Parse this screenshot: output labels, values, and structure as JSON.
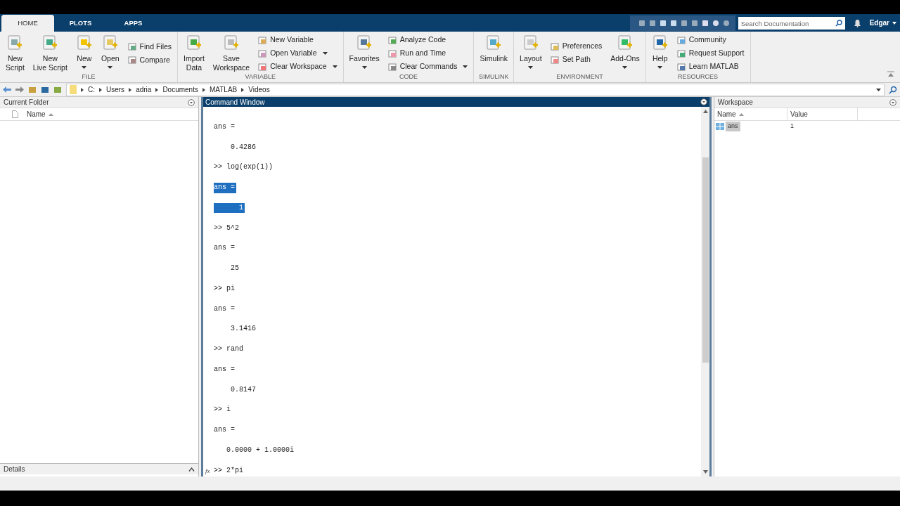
{
  "tabs": [
    {
      "label": "HOME",
      "selected": true
    },
    {
      "label": "PLOTS",
      "selected": false
    },
    {
      "label": "APPS",
      "selected": false
    }
  ],
  "search": {
    "placeholder": "Search Documentation"
  },
  "user": "Edgar",
  "sections": [
    {
      "title": "FILE",
      "columns": [
        {
          "kind": "large",
          "label": "New\nScript",
          "dropdown": false
        },
        {
          "kind": "large",
          "label": "New\nLive Script",
          "dropdown": false
        },
        {
          "kind": "large",
          "label": "New",
          "dropdown": true
        },
        {
          "kind": "large",
          "label": "Open",
          "dropdown": true
        },
        {
          "kind": "stack",
          "items": [
            {
              "label": "Find Files",
              "dropdown": false
            },
            {
              "label": "Compare",
              "dropdown": false
            }
          ]
        }
      ]
    },
    {
      "title": "VARIABLE",
      "columns": [
        {
          "kind": "large",
          "label": "Import\nData",
          "dropdown": false
        },
        {
          "kind": "large",
          "label": "Save\nWorkspace",
          "dropdown": false
        },
        {
          "kind": "stack",
          "items": [
            {
              "label": "New Variable",
              "dropdown": false
            },
            {
              "label": "Open Variable",
              "dropdown": true
            },
            {
              "label": "Clear Workspace",
              "dropdown": true
            }
          ]
        }
      ]
    },
    {
      "title": "CODE",
      "columns": [
        {
          "kind": "large",
          "label": "Favorites",
          "dropdown": true
        },
        {
          "kind": "stack",
          "items": [
            {
              "label": "Analyze Code",
              "dropdown": false
            },
            {
              "label": "Run and Time",
              "dropdown": false
            },
            {
              "label": "Clear Commands",
              "dropdown": true
            }
          ]
        }
      ]
    },
    {
      "title": "SIMULINK",
      "columns": [
        {
          "kind": "large",
          "label": "Simulink",
          "dropdown": false
        }
      ]
    },
    {
      "title": "ENVIRONMENT",
      "columns": [
        {
          "kind": "large",
          "label": "Layout",
          "dropdown": true
        },
        {
          "kind": "stack",
          "items": [
            {
              "label": "Preferences",
              "dropdown": false
            },
            {
              "label": "Set Path",
              "dropdown": false
            }
          ]
        },
        {
          "kind": "large",
          "label": "Add-Ons",
          "dropdown": true
        }
      ]
    },
    {
      "title": "RESOURCES",
      "columns": [
        {
          "kind": "large",
          "label": "Help",
          "dropdown": true
        },
        {
          "kind": "stack",
          "items": [
            {
              "label": "Community",
              "dropdown": false
            },
            {
              "label": "Request Support",
              "dropdown": false
            },
            {
              "label": "Learn MATLAB",
              "dropdown": false
            }
          ]
        }
      ]
    }
  ],
  "path": [
    "C:",
    "Users",
    "adria",
    "Documents",
    "MATLAB",
    "Videos"
  ],
  "current_folder": {
    "title": "Current Folder",
    "columns": [
      "Name"
    ],
    "details": "Details"
  },
  "command_window": {
    "title": "Command Window",
    "prompt_icon": "fx",
    "entries": [
      {
        "kind": "output",
        "text": "ans =",
        "selected": false
      },
      {
        "kind": "output",
        "text": "    0.4286",
        "selected": false
      },
      {
        "kind": "prompt",
        "text": ">> log(exp(1))",
        "selected": false
      },
      {
        "kind": "output",
        "text": "ans =",
        "selected": true
      },
      {
        "kind": "output",
        "text": "      1",
        "selected": true
      },
      {
        "kind": "prompt",
        "text": ">> 5^2",
        "selected": false
      },
      {
        "kind": "output",
        "text": "ans =",
        "selected": false
      },
      {
        "kind": "output",
        "text": "    25",
        "selected": false
      },
      {
        "kind": "prompt",
        "text": ">> pi",
        "selected": false
      },
      {
        "kind": "output",
        "text": "ans =",
        "selected": false
      },
      {
        "kind": "output",
        "text": "    3.1416",
        "selected": false
      },
      {
        "kind": "prompt",
        "text": ">> rand",
        "selected": false
      },
      {
        "kind": "output",
        "text": "ans =",
        "selected": false
      },
      {
        "kind": "output",
        "text": "    0.8147",
        "selected": false
      },
      {
        "kind": "prompt",
        "text": ">> i",
        "selected": false
      },
      {
        "kind": "output",
        "text": "ans =",
        "selected": false
      },
      {
        "kind": "output",
        "text": "   0.0000 + 1.0000i",
        "selected": false
      },
      {
        "kind": "current",
        "text": ">> 2*pi",
        "selected": false
      }
    ]
  },
  "workspace": {
    "title": "Workspace",
    "columns": [
      "Name",
      "Value"
    ],
    "rows": [
      {
        "name": "ans",
        "value": "1",
        "selected": true
      }
    ]
  }
}
